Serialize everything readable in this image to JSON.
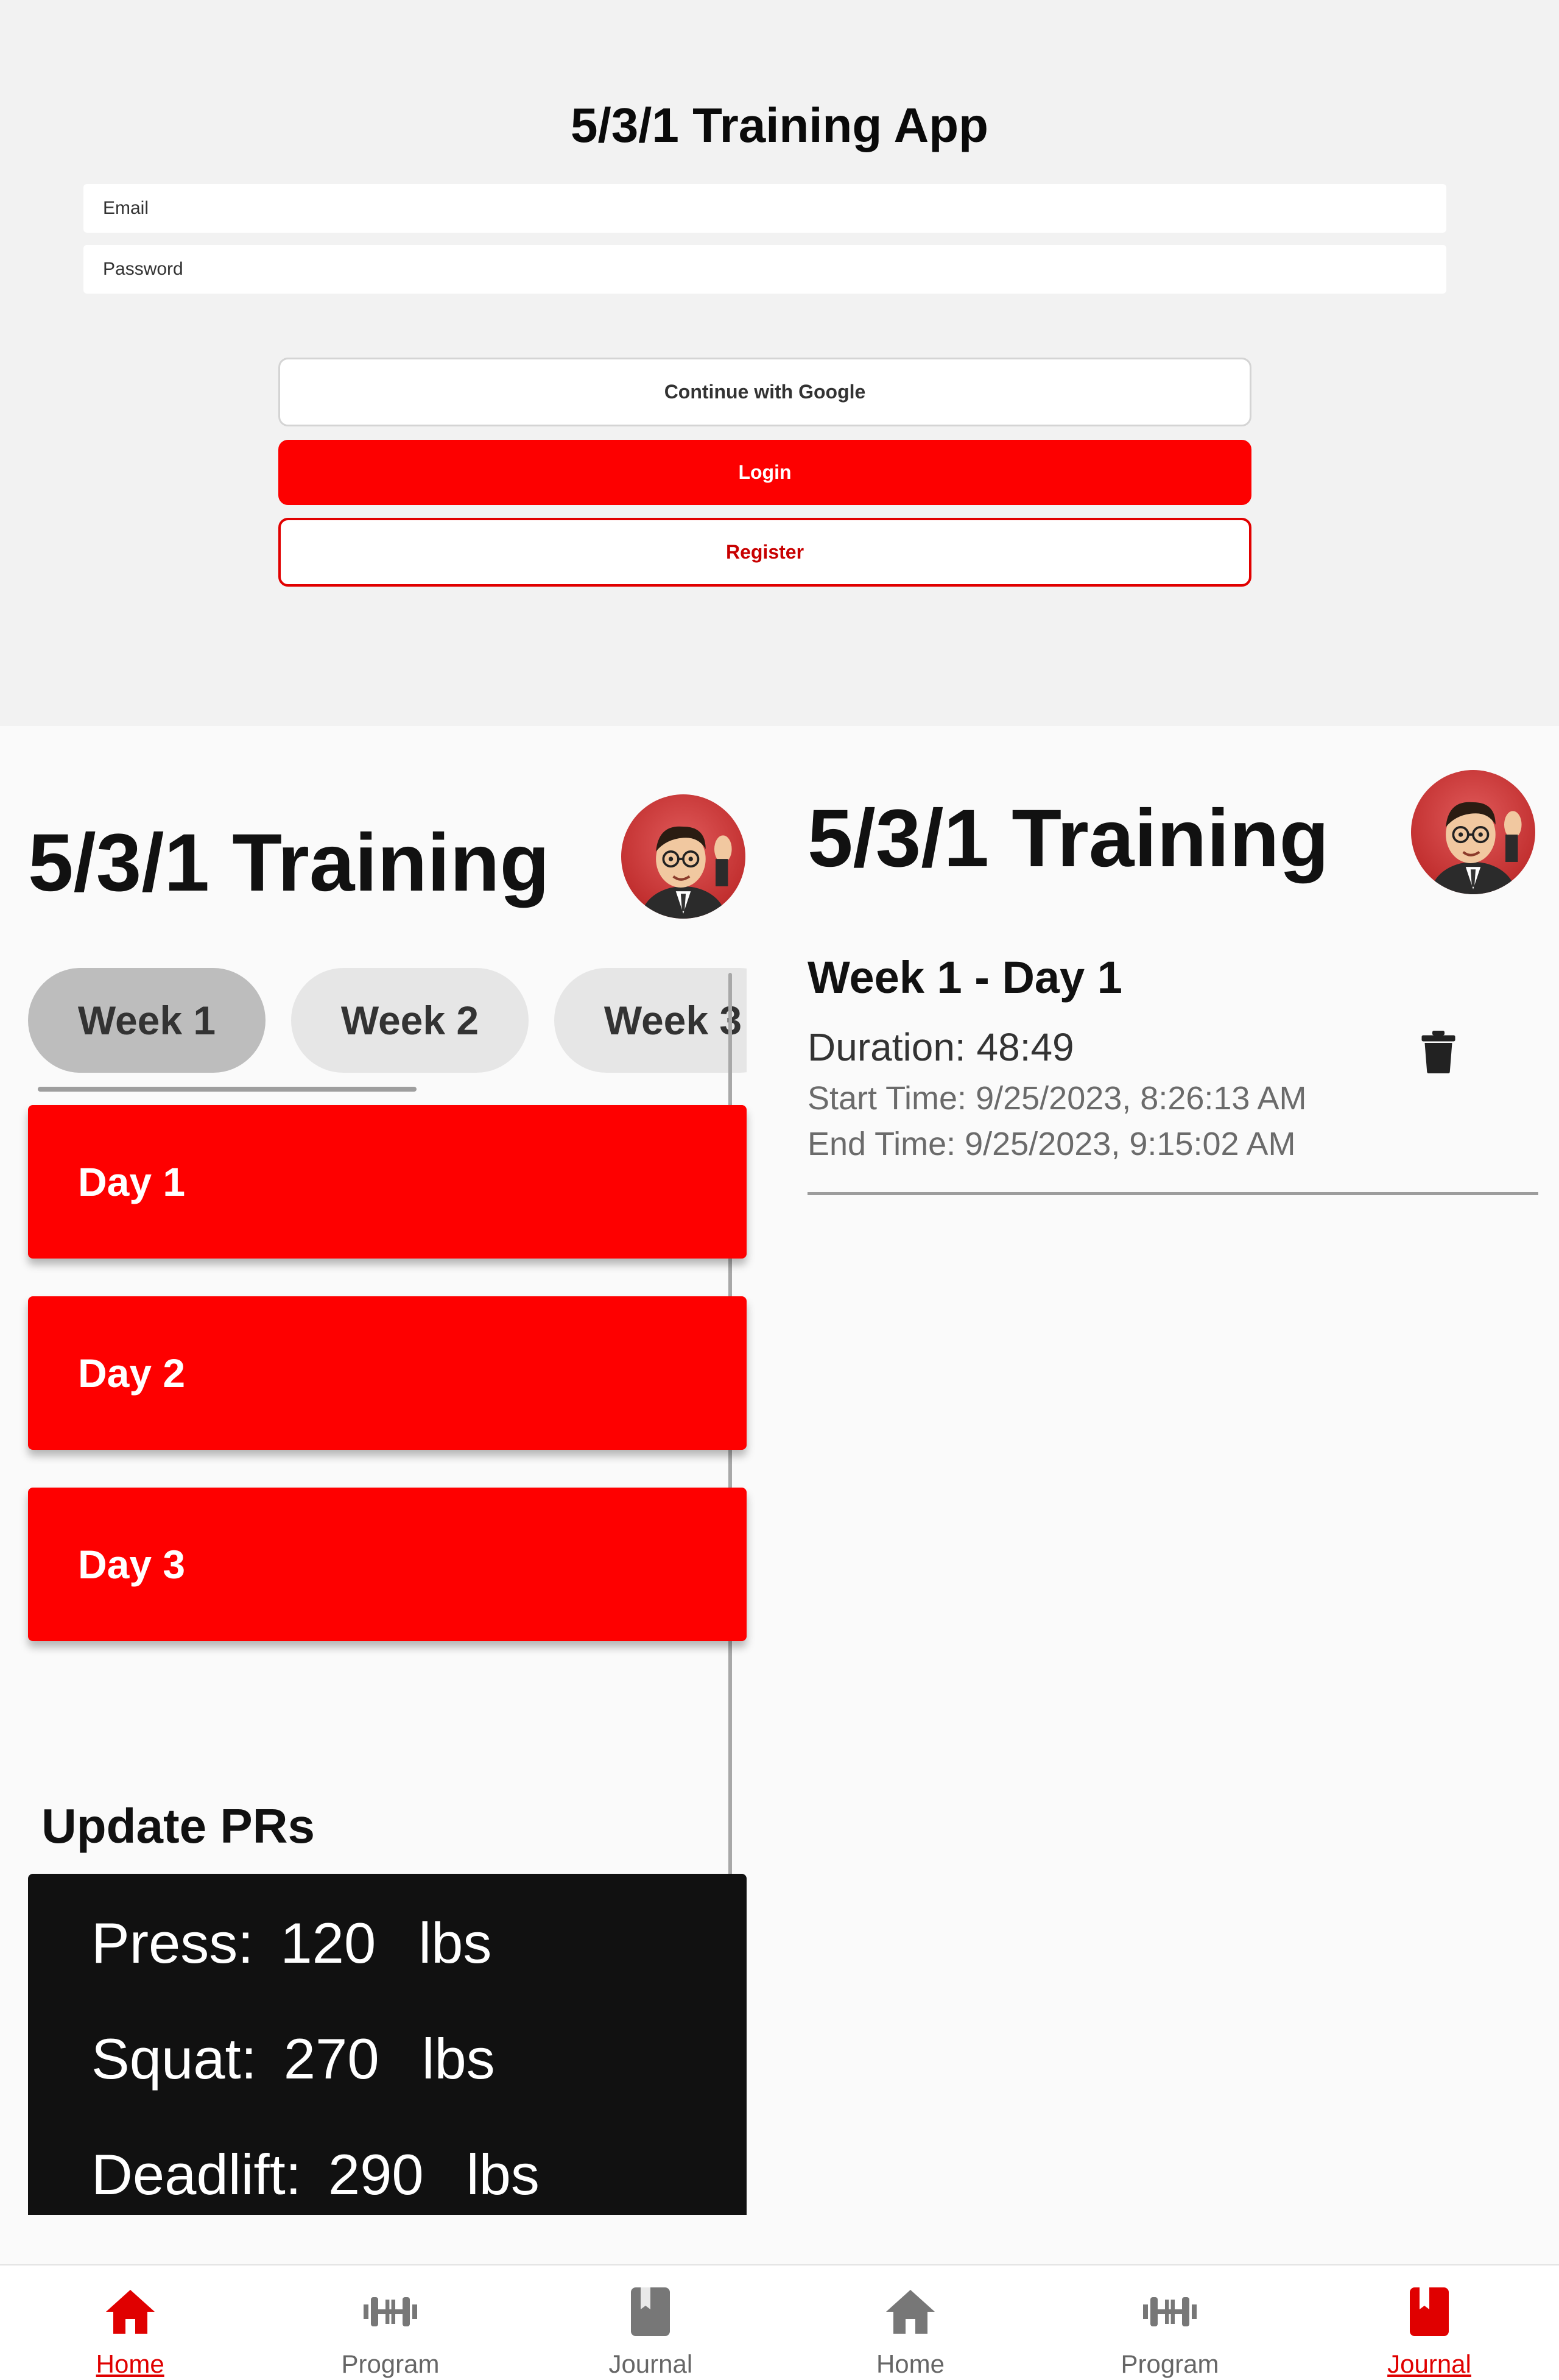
{
  "login": {
    "title": "5/3/1 Training App",
    "email_placeholder": "Email",
    "password_placeholder": "Password",
    "google_button": "Continue with Google",
    "login_button": "Login",
    "register_button": "Register"
  },
  "program_screen": {
    "app_title": "5/3/1 Training",
    "weeks": [
      {
        "label": "Week 1",
        "selected": true
      },
      {
        "label": "Week 2",
        "selected": false
      },
      {
        "label": "Week 3",
        "selected": false
      }
    ],
    "days": [
      "Day 1",
      "Day 2",
      "Day 3"
    ],
    "pr_heading": "Update PRs",
    "prs": [
      {
        "label": "Press:",
        "value": "120",
        "unit": "lbs"
      },
      {
        "label": "Squat:",
        "value": "270",
        "unit": "lbs"
      },
      {
        "label": "Deadlift:",
        "value": "290",
        "unit": "lbs"
      }
    ]
  },
  "journal_screen": {
    "app_title": "5/3/1 Training",
    "entry": {
      "title": "Week 1 - Day 1",
      "duration": "Duration: 48:49",
      "start_time": "Start Time: 9/25/2023, 8:26:13 AM",
      "end_time": "End Time: 9/25/2023, 9:15:02 AM"
    }
  },
  "nav_left": [
    {
      "label": "Home",
      "icon": "home-icon",
      "active": true
    },
    {
      "label": "Program",
      "icon": "dumbbell-icon",
      "active": false
    },
    {
      "label": "Journal",
      "icon": "journal-icon",
      "active": false
    }
  ],
  "nav_right": [
    {
      "label": "Home",
      "icon": "home-icon",
      "active": false
    },
    {
      "label": "Program",
      "icon": "dumbbell-icon",
      "active": false
    },
    {
      "label": "Journal",
      "icon": "journal-icon",
      "active": true
    }
  ],
  "colors": {
    "accent": "#fe0000",
    "inactive_icon": "#777777",
    "pr_box": "#111111"
  }
}
